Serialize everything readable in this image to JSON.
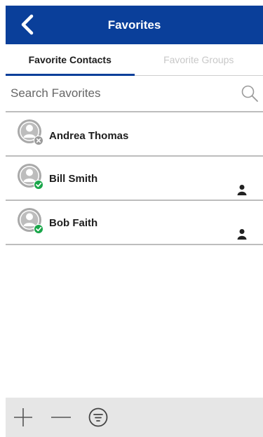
{
  "header": {
    "title": "Favorites",
    "back_icon": "chevron-left-icon"
  },
  "tabs": [
    {
      "label": "Favorite Contacts",
      "active": true
    },
    {
      "label": "Favorite Groups",
      "active": false
    }
  ],
  "search": {
    "placeholder": "Search Favorites",
    "value": "",
    "icon": "search-icon"
  },
  "contacts": [
    {
      "name": "Andrea Thomas",
      "status": "offline",
      "person_icon": false
    },
    {
      "name": "Bill Smith",
      "status": "online",
      "person_icon": true
    },
    {
      "name": "Bob Faith",
      "status": "online",
      "person_icon": true
    }
  ],
  "footer": {
    "icons": [
      "plus-icon",
      "minus-icon",
      "filter-icon"
    ]
  },
  "colors": {
    "brand_blue": "#0a3f9a",
    "online_green": "#1aa64a",
    "offline_gray": "#9a9a9a"
  }
}
